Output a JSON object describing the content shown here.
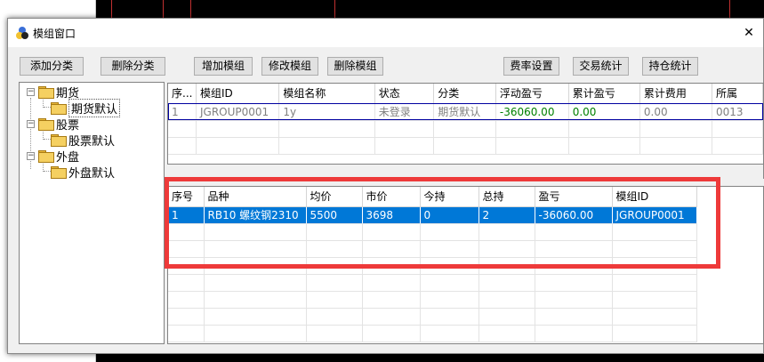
{
  "window": {
    "title": "模组窗口",
    "close_glyph": "✕"
  },
  "toolbar": {
    "add_category": "添加分类",
    "delete_category": "删除分类",
    "add_group": "增加模组",
    "modify_group": "修改模组",
    "delete_group": "删除模组",
    "fee_settings": "费率设置",
    "trade_stats": "交易统计",
    "position_stats": "持仓统计"
  },
  "tree": {
    "nodes": [
      {
        "label": "期货",
        "children": [
          {
            "label": "期货默认"
          }
        ]
      },
      {
        "label": "股票",
        "children": [
          {
            "label": "股票默认"
          }
        ]
      },
      {
        "label": "外盘",
        "children": [
          {
            "label": "外盘默认"
          }
        ]
      }
    ],
    "expander_glyph": "−"
  },
  "group_table": {
    "columns": [
      "序...",
      "模组ID",
      "模组名称",
      "状态",
      "分类",
      "浮动盈亏",
      "累计盈亏",
      "累计费用",
      "所属"
    ],
    "rows": [
      [
        "1",
        "JGROUP0001",
        "1y",
        "未登录",
        "期货默认",
        "-36060.00",
        "0.00",
        "0.00",
        "0013"
      ]
    ]
  },
  "position_table": {
    "columns": [
      "序号",
      "品种",
      "均价",
      "市价",
      "今持",
      "总持",
      "盈亏",
      "模组ID"
    ],
    "rows": [
      [
        "1",
        "RB10 螺纹钢2310",
        "5500",
        "3698",
        "0",
        "2",
        "-36060.00",
        "JGROUP0001"
      ]
    ]
  },
  "colors": {
    "highlight_box": "#ee3a3a",
    "selection": "#0078d7",
    "profit_green": "#008000"
  }
}
